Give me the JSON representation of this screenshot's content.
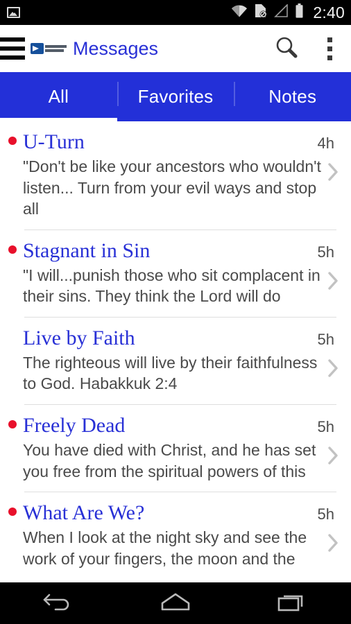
{
  "status_bar": {
    "left_icons": [
      {
        "name": "image-icon"
      }
    ],
    "right_icons": [
      {
        "name": "wifi-icon"
      },
      {
        "name": "sd-card-off-icon"
      },
      {
        "name": "signal-icon"
      },
      {
        "name": "battery-icon"
      }
    ],
    "clock": "2:40"
  },
  "app_bar": {
    "menu_icon": "hamburger-menu-icon",
    "logo": "app-logo",
    "title": "Messages",
    "search_icon": "search-icon",
    "overflow_icon": "overflow-menu-icon"
  },
  "tabs": {
    "active_index": 0,
    "items": [
      {
        "label": "All"
      },
      {
        "label": "Favorites"
      },
      {
        "label": "Notes"
      }
    ]
  },
  "messages": [
    {
      "unread": true,
      "title": "U-Turn",
      "time": "4h",
      "preview": "\"Don't be like your ancestors who wouldn't listen... Turn from your evil ways and stop all"
    },
    {
      "unread": true,
      "title": "Stagnant in Sin",
      "time": "5h",
      "preview": "\"I will...punish those who sit complacent in their sins. They think the Lord will do"
    },
    {
      "unread": false,
      "title": "Live by Faith",
      "time": "5h",
      "preview": "The righteous will live by their faithfulness to God. Habakkuk 2:4"
    },
    {
      "unread": true,
      "title": "Freely Dead",
      "time": "5h",
      "preview": "You have died with Christ, and he has set you free from the spiritual powers of this"
    },
    {
      "unread": true,
      "title": "What Are We?",
      "time": "5h",
      "preview": "When I look at the night sky and see the work of your fingers, the moon and the"
    }
  ],
  "nav_bar": {
    "back": "back-icon",
    "home": "home-icon",
    "recents": "recents-icon"
  },
  "colors": {
    "accent_blue": "#2330d8",
    "title_blue": "#2830d6",
    "unread_red": "#e8102b",
    "body_gray": "#4a4a4a"
  }
}
